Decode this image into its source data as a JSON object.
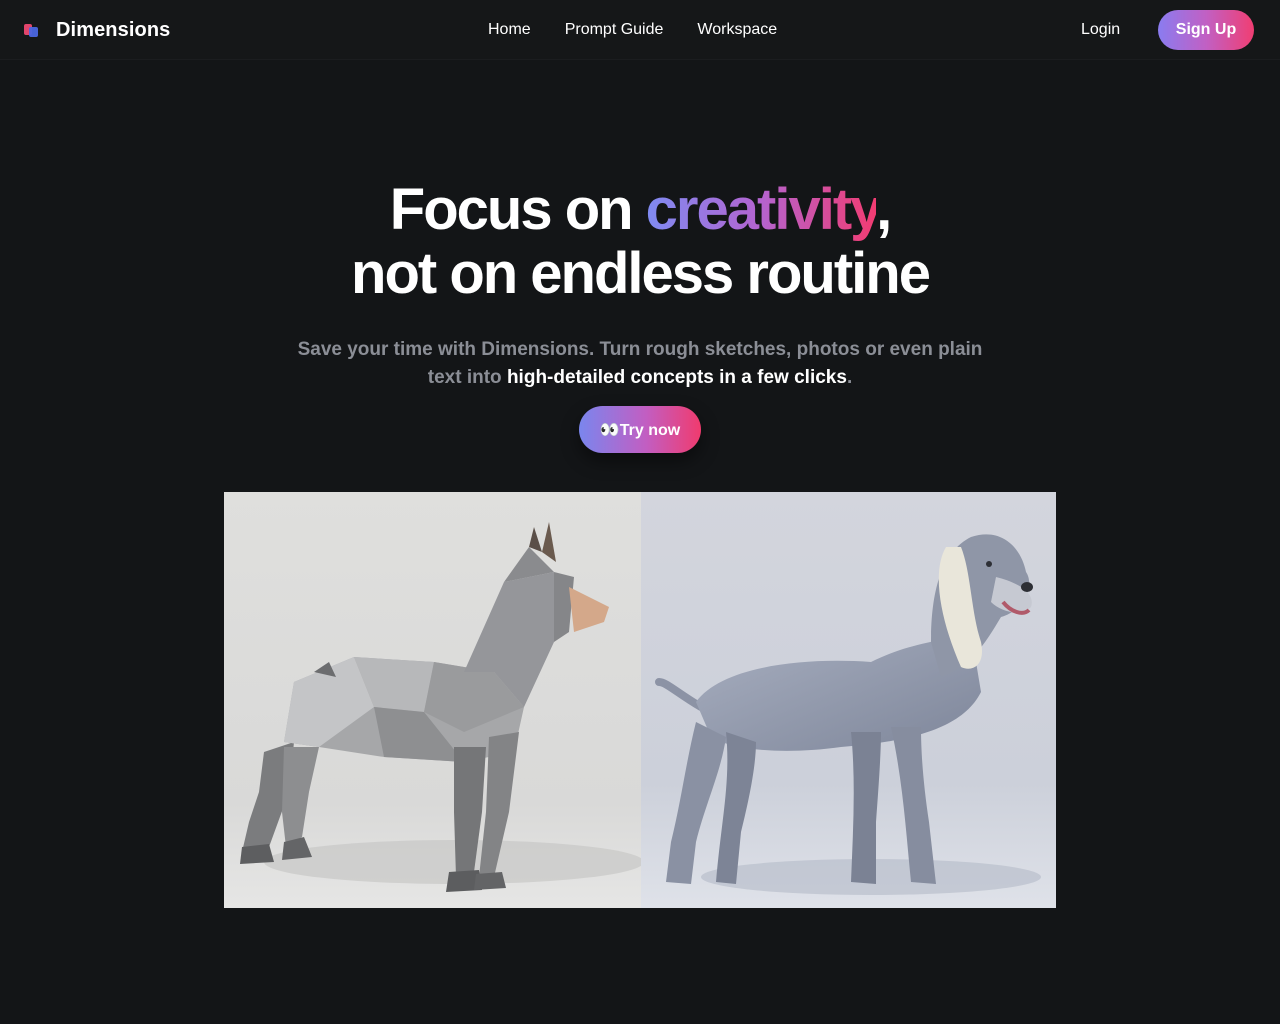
{
  "brand": {
    "name": "Dimensions",
    "logo_icon": "dimensions-logo-icon"
  },
  "nav": {
    "links": [
      "Home",
      "Prompt Guide",
      "Workspace"
    ],
    "login": "Login",
    "signup": "Sign Up"
  },
  "hero": {
    "title_part1": "Focus on ",
    "title_highlight": "creativity",
    "title_part2": ",",
    "title_line2": "not on endless routine",
    "subtitle_plain": "Save your time with Dimensions. Turn rough sketches, photos or even plain text into ",
    "subtitle_highlight": "high-detailed concepts in a few clicks",
    "subtitle_end": ".",
    "cta": "👀Try now"
  },
  "colors": {
    "background": "#131517",
    "accent_start": "#7f8bf2",
    "accent_mid": "#b463cf",
    "accent_end": "#f23c72",
    "muted_text": "#8b8e96"
  },
  "comparison": {
    "left": "low-poly-dog-model",
    "right": "realistic-dog-render"
  }
}
